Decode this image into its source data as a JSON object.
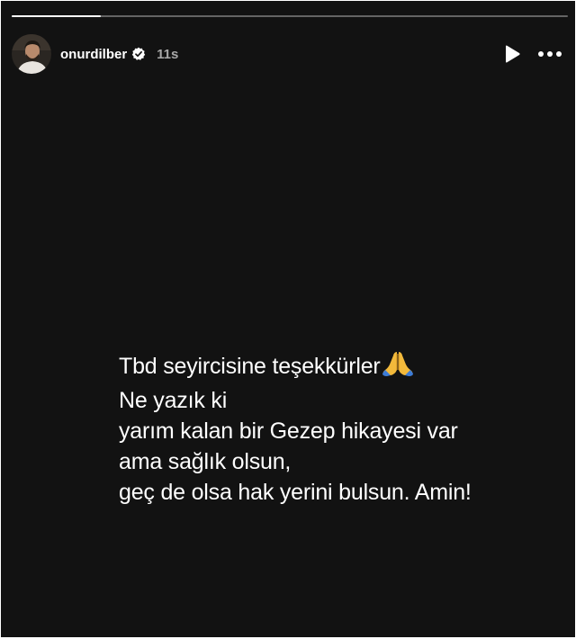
{
  "story": {
    "progress": 0.16,
    "user": {
      "username": "onurdilber",
      "verified": true,
      "time_ago": "11s",
      "avatar": "profile-photo"
    },
    "controls": {
      "play_icon": "play-icon",
      "more_icon": "more-options-icon"
    },
    "caption": {
      "line1": "Tbd seyircisine teşekkürler",
      "line1_emoji": "folded-hands-icon",
      "line2": "Ne yazık ki",
      "line3": "yarım kalan bir Gezep hikayesi var",
      "line4": "ama sağlık olsun,",
      "line5": "geç de olsa hak yerini bulsun. Amin!"
    },
    "colors": {
      "background": "#121212",
      "text": "#ffffff",
      "muted": "#a8a8a8",
      "verified": "#ffffff"
    }
  }
}
